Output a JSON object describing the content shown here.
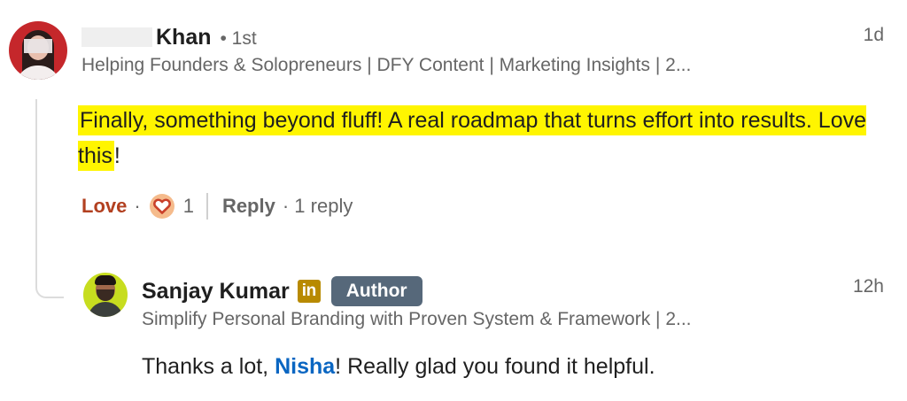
{
  "comment": {
    "author_last_name": "Khan",
    "degree": "• 1st",
    "time": "1d",
    "headline": "Helping Founders & Solopreneurs | DFY Content | Marketing Insights | 2...",
    "text_main": "Finally, something beyond fluff! A real roadmap that turns effort into results. Love this",
    "text_end": "!",
    "actions": {
      "reaction_label": "Love",
      "separator": "·",
      "reaction_icon": "heart-icon",
      "reaction_count": "1",
      "reply_label": "Reply",
      "replies_text": "· 1 reply"
    }
  },
  "reply": {
    "author_name": "Sanjay Kumar",
    "linkedin_badge": "in",
    "author_badge": "Author",
    "time": "12h",
    "headline": "Simplify Personal Branding with Proven System & Framework | 2...",
    "text_before": "Thanks a lot, ",
    "mention": "Nisha",
    "text_after": "! Really glad you found it helpful."
  },
  "colors": {
    "highlight": "#fff500",
    "love_red": "#b24020",
    "mention_blue": "#0a66c2",
    "author_badge_bg": "#56687a",
    "linkedin_gold": "#b88a00"
  }
}
